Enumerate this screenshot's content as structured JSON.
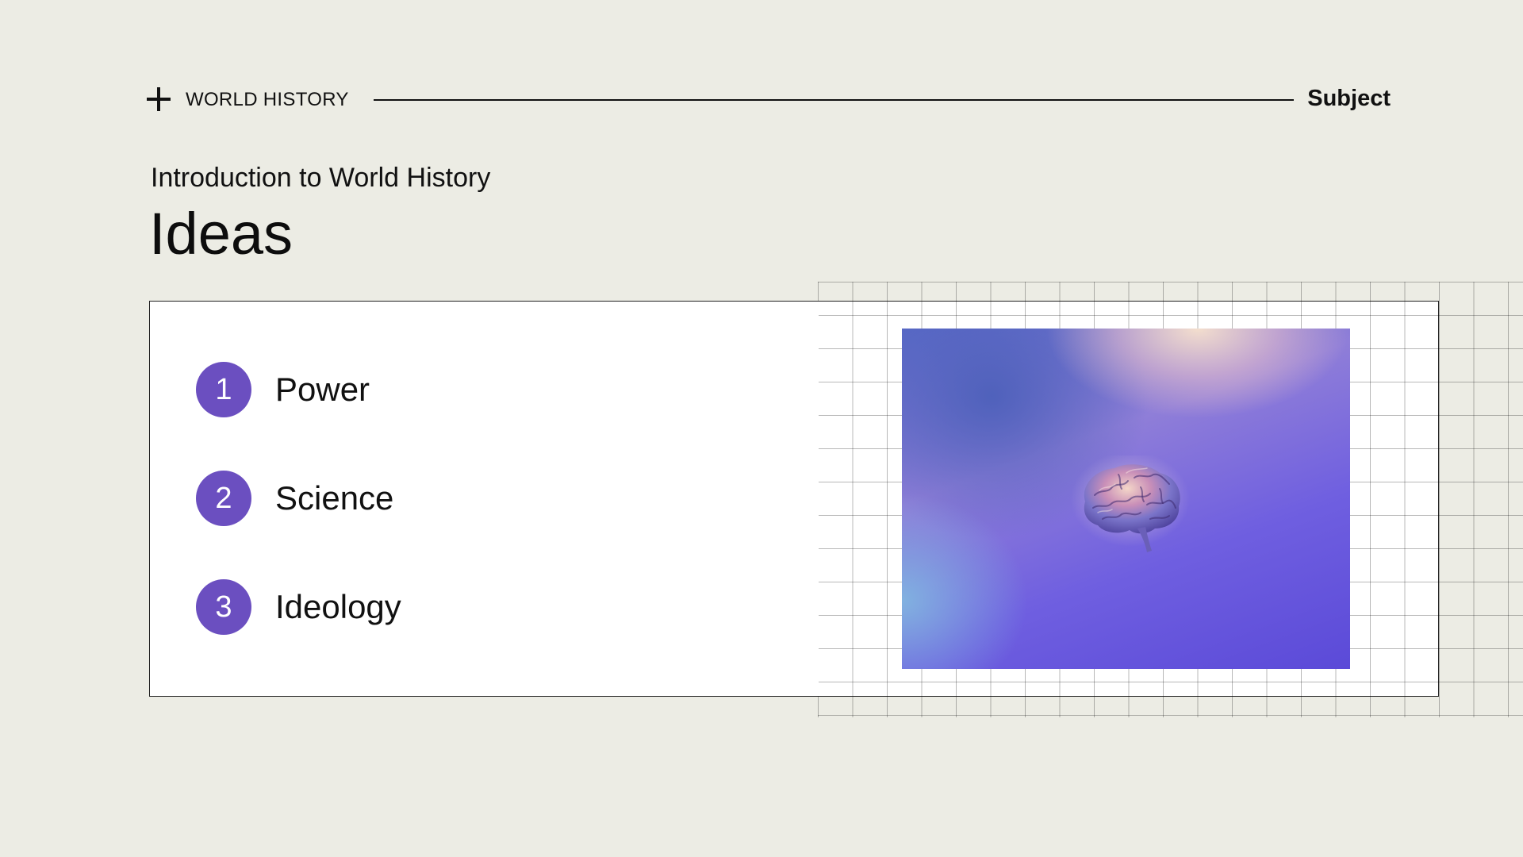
{
  "header": {
    "section": "WORLD HISTORY",
    "category": "Subject"
  },
  "subtitle": "Introduction to World History",
  "title": "Ideas",
  "items": [
    {
      "number": "1",
      "label": "Power"
    },
    {
      "number": "2",
      "label": "Science"
    },
    {
      "number": "3",
      "label": "Ideology"
    }
  ],
  "image": {
    "subject": "brain-illustration"
  },
  "colors": {
    "background": "#ecece4",
    "accent": "#6b4fc0",
    "card": "#ffffff"
  }
}
